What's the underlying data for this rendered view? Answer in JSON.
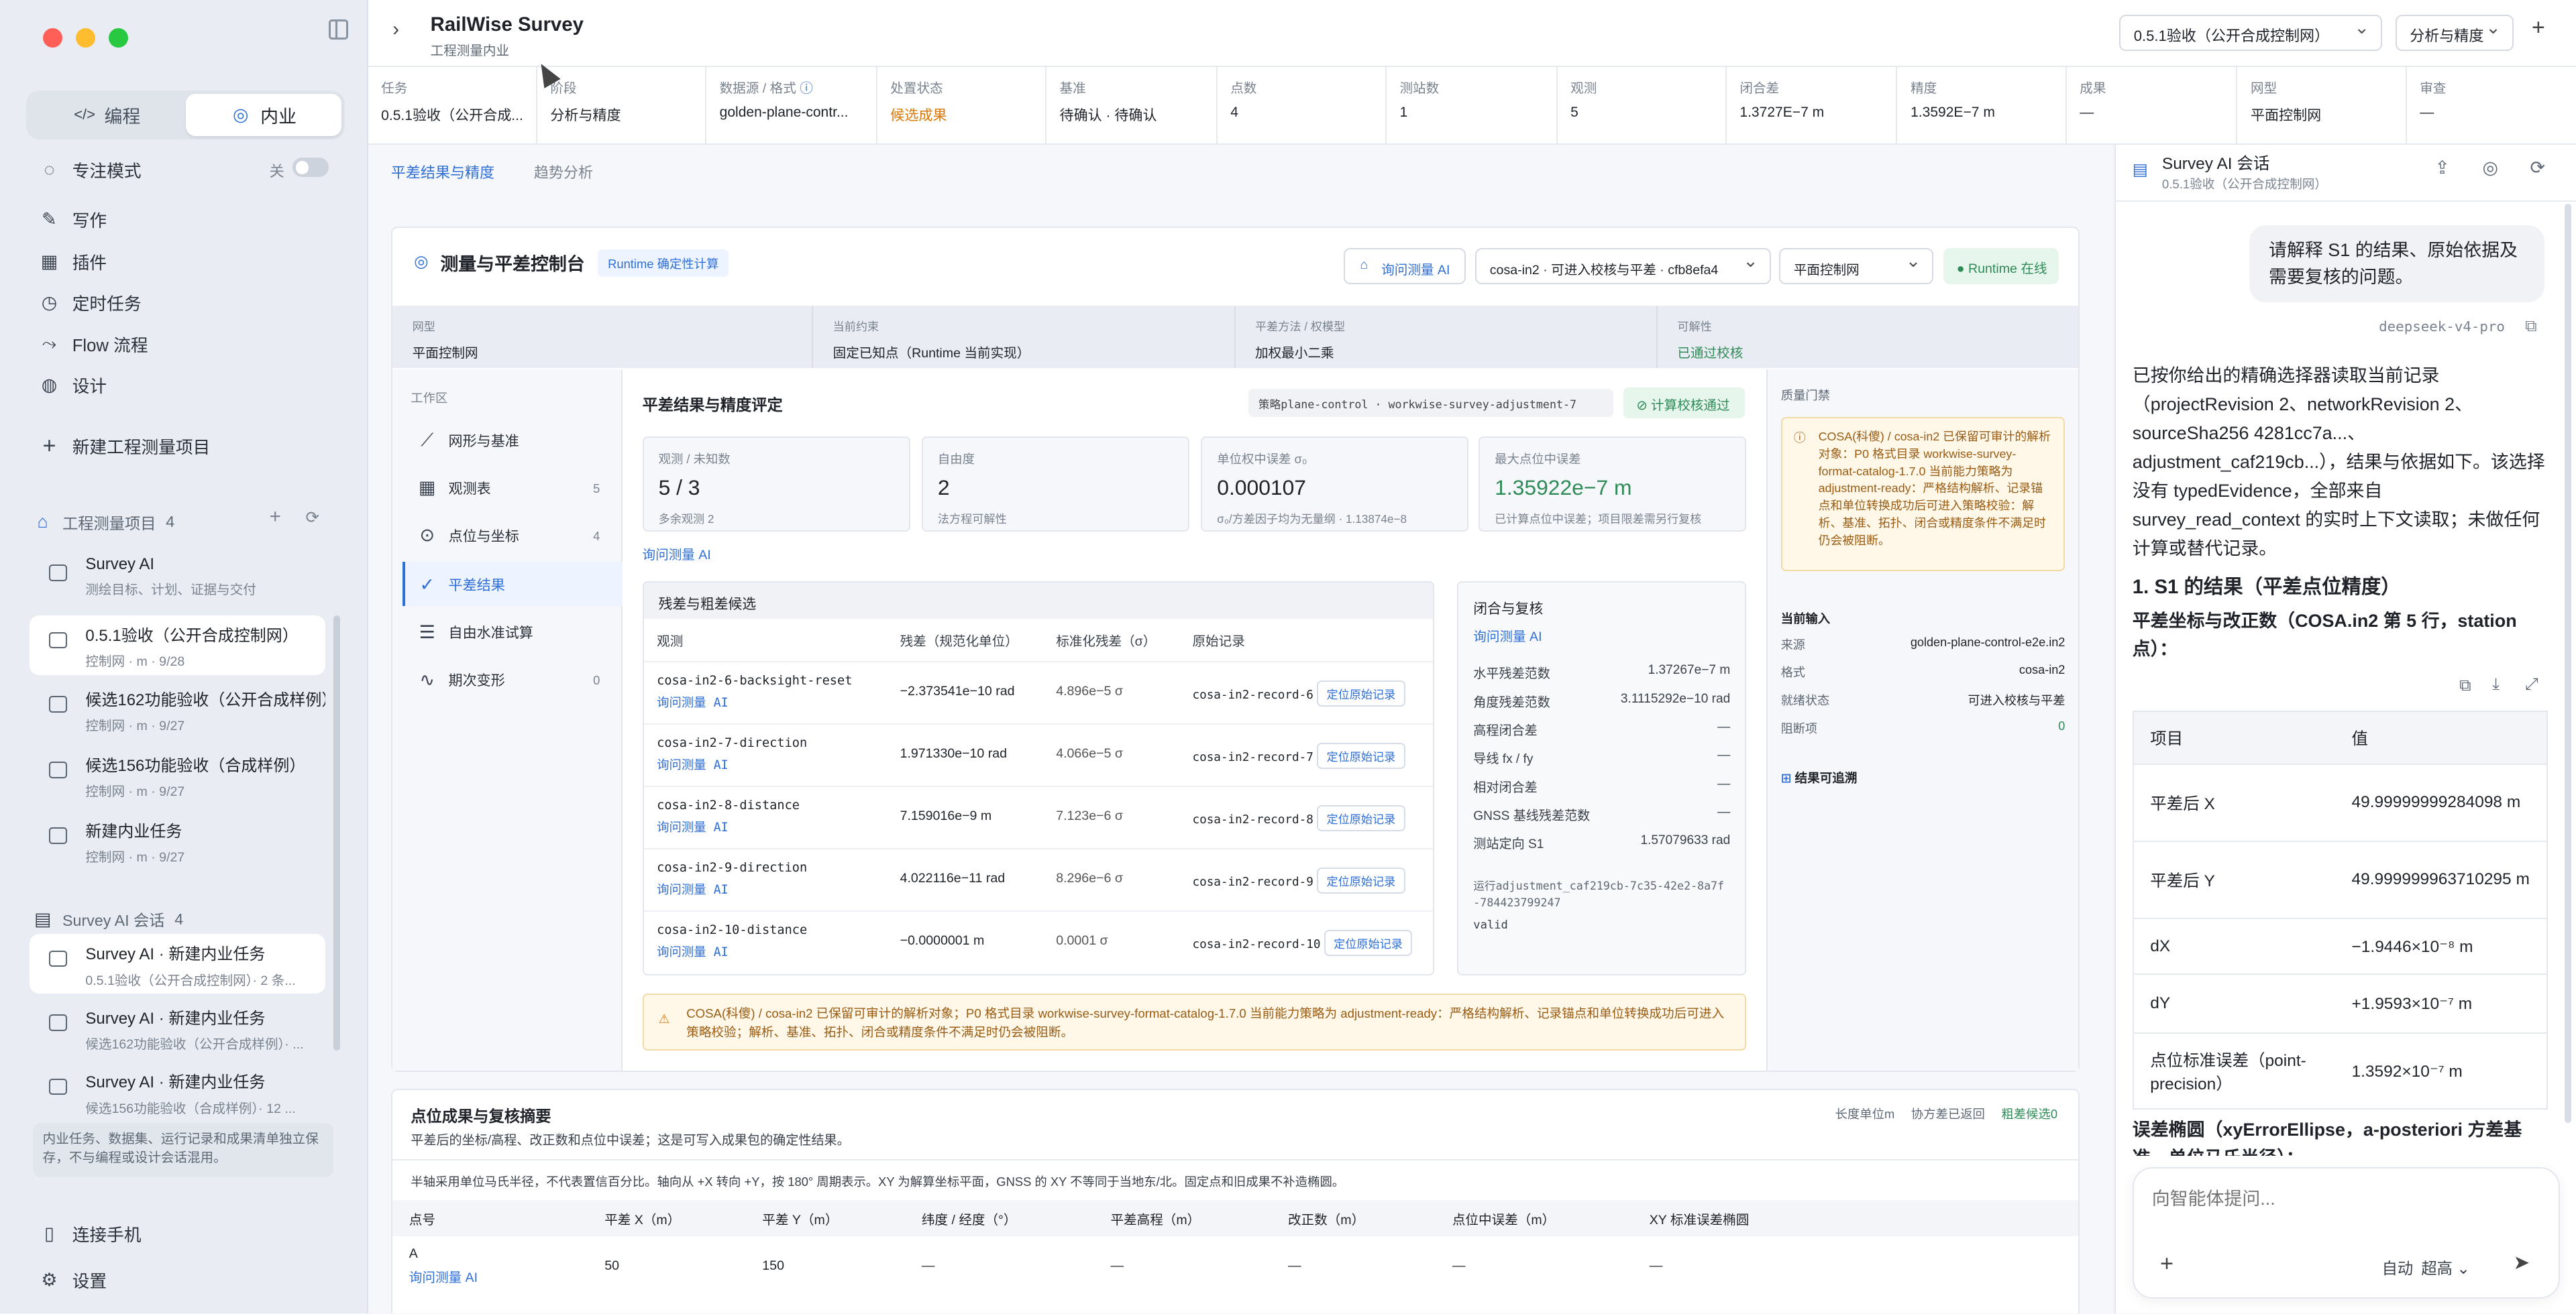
{
  "app": {
    "title": "RailWise Survey",
    "subtitle": "工程测量内业"
  },
  "sidebar": {
    "mode_tabs": [
      {
        "label": "编程"
      },
      {
        "label": "内业"
      }
    ],
    "focus": {
      "label": "专注模式",
      "state": "关"
    },
    "nav": [
      {
        "label": "写作",
        "icon": "pen-icon"
      },
      {
        "label": "插件",
        "icon": "grid-icon"
      },
      {
        "label": "定时任务",
        "icon": "clock-icon"
      },
      {
        "label": "Flow 流程",
        "icon": "flow-icon"
      },
      {
        "label": "设计",
        "icon": "palette-icon"
      }
    ],
    "new_project": "新建工程测量项目",
    "projects_header": {
      "label": "工程测量项目",
      "count": "4"
    },
    "projects": [
      {
        "title": "Survey AI",
        "sub": "测绘目标、计划、证据与交付"
      },
      {
        "title": "0.5.1验收（公开合成控制网）",
        "sub": "控制网 · m · 9/28"
      },
      {
        "title": "候选162功能验收（公开合成样例）",
        "sub": "控制网 · m · 9/27"
      },
      {
        "title": "候选156功能验收（合成样例）",
        "sub": "控制网 · m · 9/27"
      },
      {
        "title": "新建内业任务",
        "sub": "控制网 · m · 9/27"
      }
    ],
    "sessions_header": {
      "label": "Survey AI 会话",
      "count": "4"
    },
    "sessions": [
      {
        "title": "Survey AI · 新建内业任务",
        "sub": "0.5.1验收（公开合成控制网）· 2 条..."
      },
      {
        "title": "Survey AI · 新建内业任务",
        "sub": "候选162功能验收（公开合成样例）· ..."
      },
      {
        "title": "Survey AI · 新建内业任务",
        "sub": "候选156功能验收（合成样例）· 12 ..."
      }
    ],
    "hint": "内业任务、数据集、运行记录和成果清单独立保存，不与编程或设计会话混用。",
    "connect_phone": "连接手机",
    "settings": "设置"
  },
  "topbar": {
    "project_select": "0.5.1验收（公开合成控制网）",
    "view_select": "分析与精度"
  },
  "meta": [
    {
      "label": "任务",
      "value": "0.5.1验收（公开合成..."
    },
    {
      "label": "阶段",
      "value": "分析与精度"
    },
    {
      "label": "数据源 / 格式",
      "value": "golden-plane-contr..."
    },
    {
      "label": "处置状态",
      "value": "候选成果"
    },
    {
      "label": "基准",
      "value": "待确认 · 待确认"
    },
    {
      "label": "点数",
      "value": "4"
    },
    {
      "label": "测站数",
      "value": "1"
    },
    {
      "label": "观测",
      "value": "5"
    },
    {
      "label": "闭合差",
      "value": "1.3727E−7 m"
    },
    {
      "label": "精度",
      "value": "1.3592E−7 m"
    },
    {
      "label": "成果",
      "value": "—"
    },
    {
      "label": "网型",
      "value": "平面控制网"
    },
    {
      "label": "审查",
      "value": "—"
    }
  ],
  "tabs": [
    "平差结果与精度",
    "趋势分析"
  ],
  "console": {
    "title": "测量与平差控制台",
    "badge": "Runtime 确定性计算",
    "ask_ai": "询问测量 AI",
    "engine_select": "cosa-in2 · 可进入校核与平差 · cfb8efa4",
    "net_select": "平面控制网",
    "runtime": "Runtime 在线",
    "summary": [
      {
        "label": "网型",
        "value": "平面控制网"
      },
      {
        "label": "当前约束",
        "value": "固定已知点（Runtime 当前实现）"
      },
      {
        "label": "平差方法 / 权模型",
        "value": "加权最小二乘"
      },
      {
        "label": "可解性",
        "value": "已通过校核"
      }
    ]
  },
  "workspace": {
    "label": "工作区",
    "items": [
      {
        "label": "网形与基准",
        "count": ""
      },
      {
        "label": "观测表",
        "count": "5"
      },
      {
        "label": "点位与坐标",
        "count": "4"
      },
      {
        "label": "平差结果",
        "count": ""
      },
      {
        "label": "自由水准试算",
        "count": ""
      },
      {
        "label": "期次变形",
        "count": "0"
      }
    ]
  },
  "results": {
    "title": "平差结果与精度评定",
    "strategy": "策略plane-control · workwise-survey-adjustment-7",
    "pass": "计算校核通过",
    "stats": [
      {
        "label": "观测 / 未知数",
        "value": "5 / 3",
        "desc": "多余观测 2"
      },
      {
        "label": "自由度",
        "value": "2",
        "desc": "法方程可解性"
      },
      {
        "label": "单位权中误差 σ₀",
        "value": "0.000107",
        "desc": "σ₀/方差因子均为无量纲 · 1.13874e−8"
      },
      {
        "label": "最大点位中误差",
        "value": "1.35922e−7 m",
        "desc": "已计算点位中误差；项目限差需另行复核"
      }
    ],
    "ask_ai": "询问测量 AI",
    "residual_title": "残差与粗差候选",
    "columns": [
      "观测",
      "残差（规范化单位）",
      "标准化残差（σ）",
      "原始记录"
    ],
    "rows": [
      {
        "obs": "cosa-in2-6-backsight-reset",
        "res": "−2.373541e−10 rad",
        "std": "4.896e−5 σ",
        "rec": "cosa-in2-record-6"
      },
      {
        "obs": "cosa-in2-7-direction",
        "res": "1.971330e−10 rad",
        "std": "4.066e−5 σ",
        "rec": "cosa-in2-record-7"
      },
      {
        "obs": "cosa-in2-8-distance",
        "res": "7.159016e−9 m",
        "std": "7.123e−6 σ",
        "rec": "cosa-in2-record-8"
      },
      {
        "obs": "cosa-in2-9-direction",
        "res": "4.022116e−11 rad",
        "std": "8.296e−6 σ",
        "rec": "cosa-in2-record-9"
      },
      {
        "obs": "cosa-in2-10-distance",
        "res": "−0.0000001 m",
        "std": "0.0001 σ",
        "rec": "cosa-in2-record-10"
      }
    ],
    "row_ai": "询问测量 AI",
    "locate": "定位原始记录",
    "closure": {
      "title": "闭合与复核",
      "ask_ai": "询问测量 AI",
      "rows": [
        {
          "k": "水平残差范数",
          "v": "1.37267e−7 m"
        },
        {
          "k": "角度残差范数",
          "v": "3.1115292e−10 rad"
        },
        {
          "k": "高程闭合差",
          "v": "—"
        },
        {
          "k": "导线 fx / fy",
          "v": "—"
        },
        {
          "k": "相对闭合差",
          "v": "—"
        },
        {
          "k": "GNSS 基线残差范数",
          "v": "—"
        },
        {
          "k": "测站定向 S1",
          "v": "1.57079633 rad"
        }
      ],
      "run": "运行adjustment_caf219cb-7c35-42e2-8a7f-784423799247",
      "valid": "valid"
    },
    "warning": "COSA(科傻) / cosa-in2 已保留可审计的解析对象；P0 格式目录 workwise-survey-format-catalog-1.7.0 当前能力策略为 adjustment-ready：严格结构解析、记录锚点和单位转换成功后可进入策略校验；解析、基准、拓扑、闭合或精度条件不满足时仍会被阻断。"
  },
  "gate": {
    "title": "质量门禁",
    "text": "COSA(科傻) / cosa-in2 已保留可审计的解析对象：P0 格式目录 workwise-survey-format-catalog-1.7.0 当前能力策略为 adjustment-ready：严格结构解析、记录锚点和单位转换成功后可进入策略校验：解析、基准、拓扑、闭合或精度条件不满足时仍会被阻断。",
    "input_title": "当前输入",
    "inputs": [
      {
        "k": "来源",
        "v": "golden-plane-control-e2e.in2"
      },
      {
        "k": "格式",
        "v": "cosa-in2"
      },
      {
        "k": "就绪状态",
        "v": "可进入校核与平差"
      },
      {
        "k": "阻断项",
        "v": "0"
      }
    ],
    "trace": "结果可追溯"
  },
  "points": {
    "title": "点位成果与复核摘要",
    "desc": "平差后的坐标/高程、改正数和点位中误差；这是可写入成果包的确定性结果。",
    "meta": [
      "长度单位m",
      "协方差已返回",
      "粗差候选0"
    ],
    "note": "半轴采用单位马氏半径，不代表置信百分比。轴向从 +X 转向 +Y，按 180° 周期表示。XY 为解算坐标平面，GNSS 的 XY 不等同于当地东/北。固定点和旧成果不补造椭圆。",
    "columns": [
      "点号",
      "平差 X（m）",
      "平差 Y（m）",
      "纬度 / 经度（°）",
      "平差高程（m）",
      "改正数（m）",
      "点位中误差（m）",
      "XY 标准误差椭圆"
    ],
    "rows": [
      {
        "id": "A",
        "ai": "询问测量 AI",
        "x": "50",
        "y": "150",
        "latlon": "—",
        "h": "—",
        "corr": "—",
        "err": "—",
        "ell": "—"
      }
    ]
  },
  "chat": {
    "title": "Survey AI 会话",
    "subtitle": "0.5.1验收（公开合成控制网）",
    "user_msg": "请解释 S1 的结果、原始依据及需要复核的问题。",
    "model": "deepseek-v4-pro",
    "reply": "已按你给出的精确选择器读取当前记录（projectRevision 2、networkRevision 2、sourceSha256 4281cc7a...、adjustment_caf219cb...），结果与依据如下。该选择没有 typedEvidence，全部来自 survey_read_context 的实时上下文读取；未做任何计算或替代记录。",
    "h1": "1. S1 的结果（平差点位精度）",
    "sub": "平差坐标与改正数（COSA.in2 第 5 行，station 点）：",
    "table_head": [
      "项目",
      "值"
    ],
    "table": [
      {
        "k": "平差后 X",
        "v": "49.99999999284098 m"
      },
      {
        "k": "平差后 Y",
        "v": "49.999999963710295 m"
      },
      {
        "k": "dX",
        "v": "−1.9446×10⁻⁸ m"
      },
      {
        "k": "dY",
        "v": "+1.9593×10⁻⁷ m"
      },
      {
        "k": "点位标准误差（point-precision）",
        "v": "1.3592×10⁻⁷ m"
      }
    ],
    "more": "误差椭圆（xyErrorEllipse，a-posteriori 方差基准，单位马氏半径）：",
    "placeholder": "向智能体提问...",
    "auto": "自动",
    "level": "超高"
  }
}
